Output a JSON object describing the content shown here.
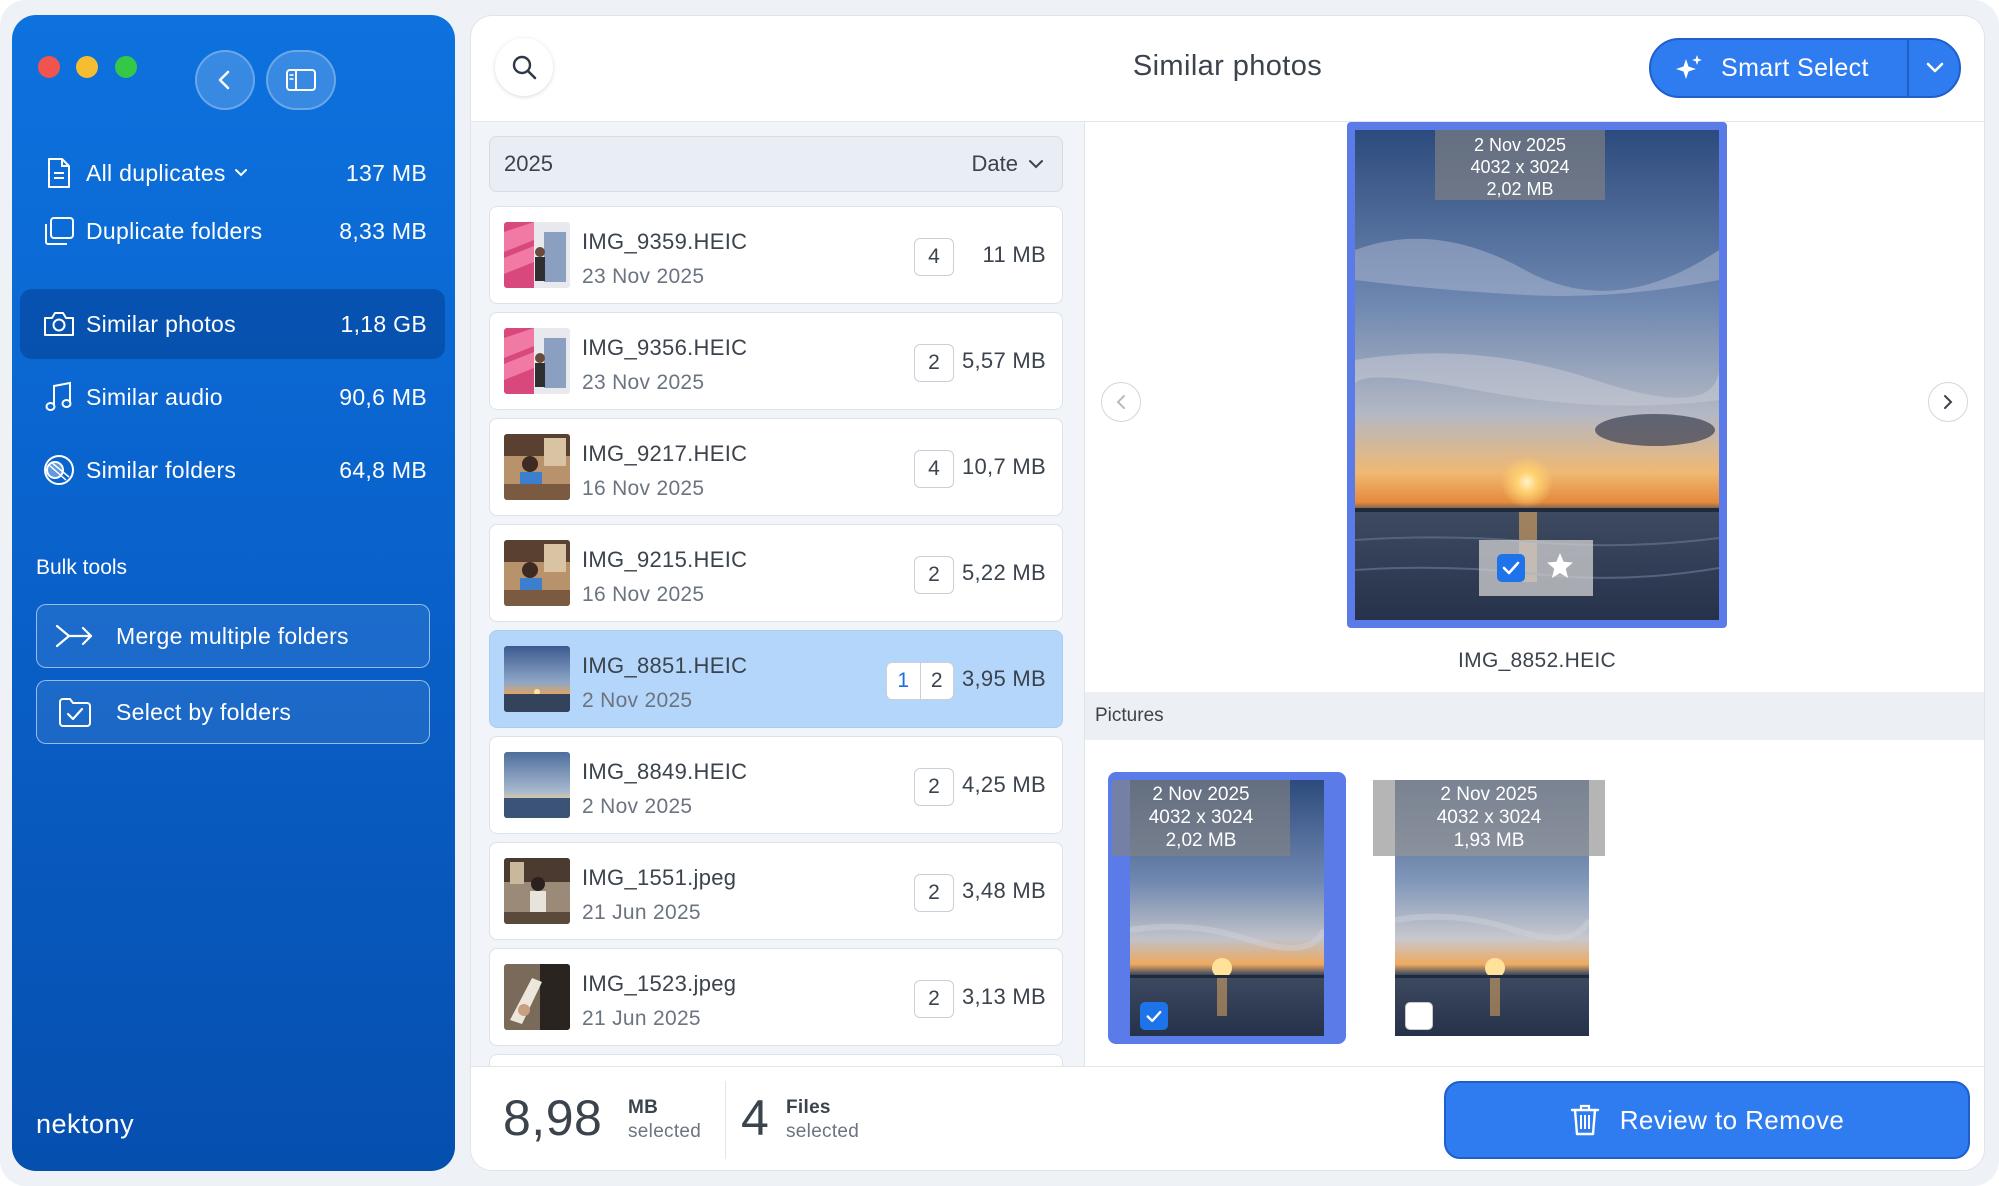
{
  "window": {
    "title": "Similar photos"
  },
  "sidebar": {
    "items": [
      {
        "label": "All duplicates",
        "size": "137 MB",
        "icon": "document-icon",
        "has_chevron": true
      },
      {
        "label": "Duplicate folders",
        "size": "8,33 MB",
        "icon": "folders-icon"
      },
      {
        "label": "Similar photos",
        "size": "1,18 GB",
        "icon": "camera-icon",
        "active": true
      },
      {
        "label": "Similar audio",
        "size": "90,6 MB",
        "icon": "music-note-icon"
      },
      {
        "label": "Similar folders",
        "size": "64,8 MB",
        "icon": "similar-folders-icon"
      }
    ],
    "bulk_tools_title": "Bulk tools",
    "bulk_tools": [
      {
        "label": "Merge multiple folders",
        "icon": "merge-arrows-icon"
      },
      {
        "label": "Select by folders",
        "icon": "folder-check-icon"
      }
    ],
    "logo": "nektony"
  },
  "toolbar": {
    "title": "Similar photos",
    "smart_select_label": "Smart Select"
  },
  "list": {
    "group": {
      "year": "2025",
      "sort_label": "Date"
    },
    "rows": [
      {
        "name": "IMG_9359.HEIC",
        "date": "23 Nov 2025",
        "count": "4",
        "size": "11 MB",
        "thumb": "pink"
      },
      {
        "name": "IMG_9356.HEIC",
        "date": "23 Nov 2025",
        "count": "2",
        "size": "5,57 MB",
        "thumb": "pink"
      },
      {
        "name": "IMG_9217.HEIC",
        "date": "16 Nov 2025",
        "count": "4",
        "size": "10,7 MB",
        "thumb": "cafe"
      },
      {
        "name": "IMG_9215.HEIC",
        "date": "16 Nov 2025",
        "count": "2",
        "size": "5,22 MB",
        "thumb": "cafe"
      },
      {
        "name": "IMG_8851.HEIC",
        "date": "2 Nov 2025",
        "count_selected": "1",
        "count": "2",
        "size": "3,95 MB",
        "thumb": "sunset",
        "selected": true
      },
      {
        "name": "IMG_8849.HEIC",
        "date": "2 Nov 2025",
        "count": "2",
        "size": "4,25 MB",
        "thumb": "sea"
      },
      {
        "name": "IMG_1551.jpeg",
        "date": "21 Jun 2025",
        "count": "2",
        "size": "3,48 MB",
        "thumb": "street"
      },
      {
        "name": "IMG_1523.jpeg",
        "date": "21 Jun 2025",
        "count": "2",
        "size": "3,13 MB",
        "thumb": "street"
      }
    ]
  },
  "preview": {
    "main": {
      "date": "2 Nov 2025",
      "dimensions": "4032 x 3024",
      "size": "2,02 MB",
      "filename": "IMG_8852.HEIC",
      "checked": true
    },
    "folder_label": "Pictures",
    "thumbnails": [
      {
        "date": "2 Nov 2025",
        "dimensions": "4032 x 3024",
        "size": "2,02 MB",
        "checked": true
      },
      {
        "date": "2 Nov 2025",
        "dimensions": "4032 x 3024",
        "size": "1,93 MB",
        "checked": false
      }
    ]
  },
  "footer": {
    "size_value": "8,98",
    "size_unit": "MB",
    "size_sub": "selected",
    "files_value": "4",
    "files_unit": "Files",
    "files_sub": "selected",
    "review_label": "Review to Remove"
  },
  "colors": {
    "sidebar": "#0a62cc",
    "accent": "#2f7cf1",
    "selected_row": "#b4d6fb",
    "selection_frame": "#5b7be8"
  }
}
